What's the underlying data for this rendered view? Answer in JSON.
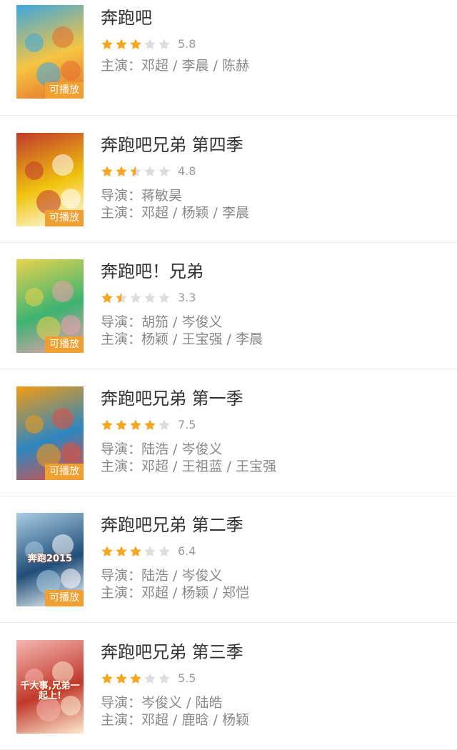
{
  "colors": {
    "star_on": "#f5a623",
    "star_off": "#dddddd",
    "badge": "#f0a030",
    "title": "#333333",
    "meta": "#888888",
    "divider": "#e8e8e8"
  },
  "playable_label": "可播放",
  "items": [
    {
      "title": "奔跑吧",
      "rating": 2.9,
      "score": "5.8",
      "director": "",
      "cast": "主演：邓超 / 李晨 / 陈赫",
      "playable": true,
      "poster_colors": [
        "#3ba7e0",
        "#f6c542",
        "#e36b2c"
      ],
      "poster_text": ""
    },
    {
      "title": "奔跑吧兄弟 第四季",
      "rating": 2.4,
      "score": "4.8",
      "director": "导演：蒋敏昊",
      "cast": "主演：邓超 / 杨颖 / 李晨",
      "playable": true,
      "poster_colors": [
        "#c0392b",
        "#f1c40f",
        "#ffffff"
      ],
      "poster_text": ""
    },
    {
      "title": "奔跑吧！兄弟",
      "rating": 1.65,
      "score": "3.3",
      "director": "导演：胡笳 / 岑俊义",
      "cast": "主演：杨颖 / 王宝强 / 李晨",
      "playable": true,
      "poster_colors": [
        "#e8d44d",
        "#3cb371",
        "#f29fb0"
      ],
      "poster_text": ""
    },
    {
      "title": "奔跑吧兄弟 第一季",
      "rating": 3.75,
      "score": "7.5",
      "director": "导演：陆浩 / 岑俊义",
      "cast": "主演：邓超 / 王祖蓝 / 王宝强",
      "playable": true,
      "poster_colors": [
        "#f39c12",
        "#2e86c1",
        "#e74c3c"
      ],
      "poster_text": ""
    },
    {
      "title": "奔跑吧兄弟 第二季",
      "rating": 3.2,
      "score": "6.4",
      "director": "导演：陆浩 / 岑俊义",
      "cast": "主演：邓超 / 杨颖 / 郑恺",
      "playable": true,
      "poster_colors": [
        "#a9cce3",
        "#1f4e79",
        "#ffffff"
      ],
      "poster_text": "奔跑2015"
    },
    {
      "title": "奔跑吧兄弟 第三季",
      "rating": 2.75,
      "score": "5.5",
      "director": "导演：岑俊义 / 陆皓",
      "cast": "主演：邓超 / 鹿晗 / 杨颖",
      "playable": false,
      "poster_colors": [
        "#f5b7b1",
        "#c0392b",
        "#fdebd0"
      ],
      "poster_text": "千大事,兄弟一起上!"
    }
  ]
}
